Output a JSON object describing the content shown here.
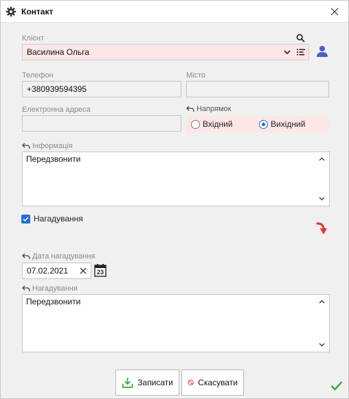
{
  "window": {
    "title": "Контакт"
  },
  "client": {
    "label": "Клієнт",
    "value": "Василина Ольга"
  },
  "phone": {
    "label": "Телефон",
    "value": "+380939594395"
  },
  "city": {
    "label": "Місто",
    "value": ""
  },
  "email": {
    "label": "Електронна адреса",
    "value": ""
  },
  "direction": {
    "label": "Напрямок",
    "options": [
      {
        "label": "Вхідний",
        "selected": false
      },
      {
        "label": "Вихідний",
        "selected": true
      }
    ]
  },
  "info": {
    "label": "Інформація",
    "value": "Передзвонити"
  },
  "reminder_checkbox": {
    "label": "Нагадування",
    "checked": true
  },
  "reminder_date": {
    "label": "Дата нагадування",
    "value": "07.02.2021",
    "calendar_day": "23"
  },
  "reminder_text": {
    "label": "Нагадування",
    "value": "Передзвонити"
  },
  "buttons": {
    "save": "Записати",
    "cancel": "Скасувати"
  },
  "colors": {
    "accent": "#1e6fd9",
    "required_bg": "#fde6e6",
    "arrow": "#e53935",
    "ok": "#2eaa44",
    "user_icon": "#4a5cc5"
  }
}
